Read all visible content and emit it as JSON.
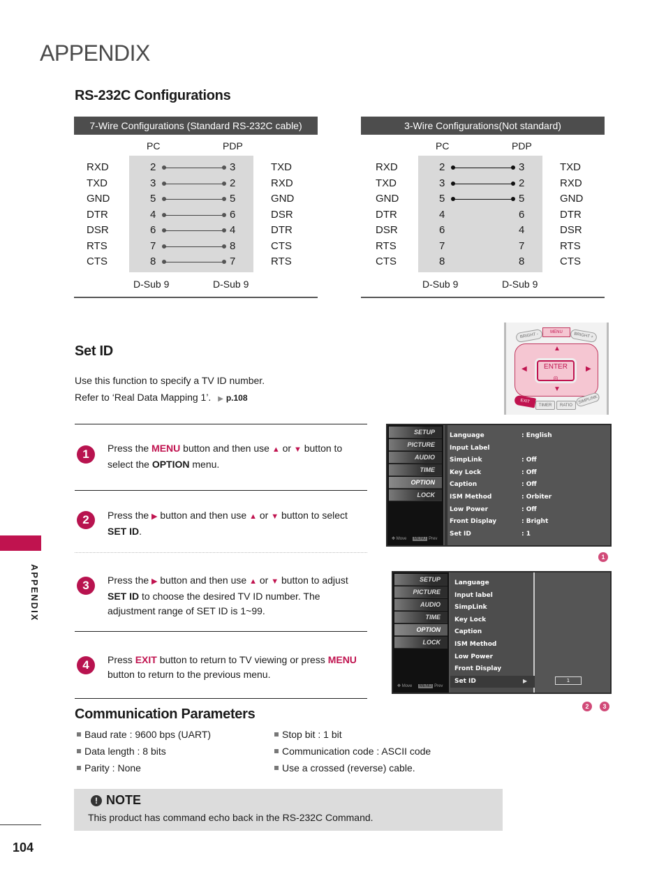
{
  "page": {
    "title": "APPENDIX",
    "side_label": "APPENDIX",
    "page_number": "104",
    "accent_color": "#c0134f"
  },
  "rs232": {
    "title": "RS-232C Configurations",
    "seven_wire": {
      "header": "7-Wire Configurations (Standard RS-232C cable)",
      "pc_label": "PC",
      "pdp_label": "PDP",
      "rows": [
        {
          "left_sig": "RXD",
          "pc_pin": "2",
          "pdp_pin": "3",
          "right_sig": "TXD",
          "connected": true
        },
        {
          "left_sig": "TXD",
          "pc_pin": "3",
          "pdp_pin": "2",
          "right_sig": "RXD",
          "connected": true
        },
        {
          "left_sig": "GND",
          "pc_pin": "5",
          "pdp_pin": "5",
          "right_sig": "GND",
          "connected": true
        },
        {
          "left_sig": "DTR",
          "pc_pin": "4",
          "pdp_pin": "6",
          "right_sig": "DSR",
          "connected": true
        },
        {
          "left_sig": "DSR",
          "pc_pin": "6",
          "pdp_pin": "4",
          "right_sig": "DTR",
          "connected": true
        },
        {
          "left_sig": "RTS",
          "pc_pin": "7",
          "pdp_pin": "8",
          "right_sig": "CTS",
          "connected": true
        },
        {
          "left_sig": "CTS",
          "pc_pin": "8",
          "pdp_pin": "7",
          "right_sig": "RTS",
          "connected": true
        }
      ],
      "pc_connector": "D-Sub 9",
      "pdp_connector": "D-Sub 9"
    },
    "three_wire": {
      "header": "3-Wire Configurations(Not standard)",
      "pc_label": "PC",
      "pdp_label": "PDP",
      "rows": [
        {
          "left_sig": "RXD",
          "pc_pin": "2",
          "pdp_pin": "3",
          "right_sig": "TXD",
          "connected": true
        },
        {
          "left_sig": "TXD",
          "pc_pin": "3",
          "pdp_pin": "2",
          "right_sig": "RXD",
          "connected": true
        },
        {
          "left_sig": "GND",
          "pc_pin": "5",
          "pdp_pin": "5",
          "right_sig": "GND",
          "connected": true
        },
        {
          "left_sig": "DTR",
          "pc_pin": "4",
          "pdp_pin": "6",
          "right_sig": "DTR",
          "connected": false
        },
        {
          "left_sig": "DSR",
          "pc_pin": "6",
          "pdp_pin": "4",
          "right_sig": "DSR",
          "connected": false
        },
        {
          "left_sig": "RTS",
          "pc_pin": "7",
          "pdp_pin": "7",
          "right_sig": "RTS",
          "connected": false
        },
        {
          "left_sig": "CTS",
          "pc_pin": "8",
          "pdp_pin": "8",
          "right_sig": "CTS",
          "connected": false
        }
      ],
      "pc_connector": "D-Sub 9",
      "pdp_connector": "D-Sub 9"
    }
  },
  "setid": {
    "title": "Set ID",
    "intro_line1": "Use this function to specify a TV ID number.",
    "intro_line2": "Refer to ‘Real Data Mapping 1’.",
    "intro_ref": "p.108",
    "steps": [
      {
        "num": "1",
        "parts": [
          "Press the ",
          "MENU",
          " button and then use ",
          "▲",
          " or ",
          "▼",
          " button to select the ",
          "OPTION",
          " menu."
        ]
      },
      {
        "num": "2",
        "parts": [
          "Press the ",
          "▶",
          " button and then use ",
          "▲",
          " or ",
          "▼",
          " button to select ",
          "SET ID",
          "."
        ]
      },
      {
        "num": "3",
        "parts": [
          "Press the ",
          "▶",
          " button and then use ",
          "▲",
          " or ",
          "▼",
          " button to adjust ",
          "SET ID",
          " to choose the desired TV ID number. The adjustment range of SET ID is 1~99."
        ]
      },
      {
        "num": "4",
        "parts": [
          "Press ",
          "EXIT",
          " button to return to TV viewing or press ",
          "MENU",
          " button to return to the previous menu."
        ]
      }
    ]
  },
  "remote": {
    "buttons": [
      "BRIGHT -",
      "MENU",
      "BRIGHT +",
      "ENTER",
      "EXIT",
      "TIMER",
      "RATIO",
      "SIMPLINK"
    ],
    "arrows": [
      "▲",
      "▼",
      "◀",
      "▶"
    ]
  },
  "osd1": {
    "side_menu": [
      "SETUP",
      "PICTURE",
      "AUDIO",
      "TIME",
      "OPTION",
      "LOCK"
    ],
    "selected": "OPTION",
    "footer_move": "Move",
    "footer_menu": "MENU",
    "footer_prev": "Prev",
    "rows": [
      {
        "label": "Language",
        "value": ": English"
      },
      {
        "label": "Input Label",
        "value": ""
      },
      {
        "label": "SimpLink",
        "value": ": Off"
      },
      {
        "label": "Key Lock",
        "value": ": Off"
      },
      {
        "label": "Caption",
        "value": ": Off"
      },
      {
        "label": "ISM Method",
        "value": ": Orbiter"
      },
      {
        "label": "Low Power",
        "value": ": Off"
      },
      {
        "label": "Front Display",
        "value": ": Bright"
      },
      {
        "label": "Set ID",
        "value": ": 1"
      }
    ],
    "badge": "1"
  },
  "osd2": {
    "side_menu": [
      "SETUP",
      "PICTURE",
      "AUDIO",
      "TIME",
      "OPTION",
      "LOCK"
    ],
    "selected": "OPTION",
    "footer_move": "Move",
    "footer_menu": "MENU",
    "footer_prev": "Prev",
    "rows": [
      "Language",
      "Input label",
      "SimpLink",
      "Key Lock",
      "Caption",
      "ISM Method",
      "Low Power",
      "Front Display",
      "Set ID"
    ],
    "selected_row": "Set ID",
    "setid_value": "1",
    "badges": [
      "2",
      "3"
    ]
  },
  "comm": {
    "title": "Communication Parameters",
    "left": [
      "Baud rate : 9600 bps (UART)",
      "Data length : 8 bits",
      "Parity : None"
    ],
    "right": [
      "Stop bit : 1 bit",
      "Communication code : ASCII code",
      "Use a crossed (reverse) cable."
    ]
  },
  "note": {
    "title": "NOTE",
    "icon": "!",
    "text": "This product has command echo back in the RS-232C Command."
  }
}
